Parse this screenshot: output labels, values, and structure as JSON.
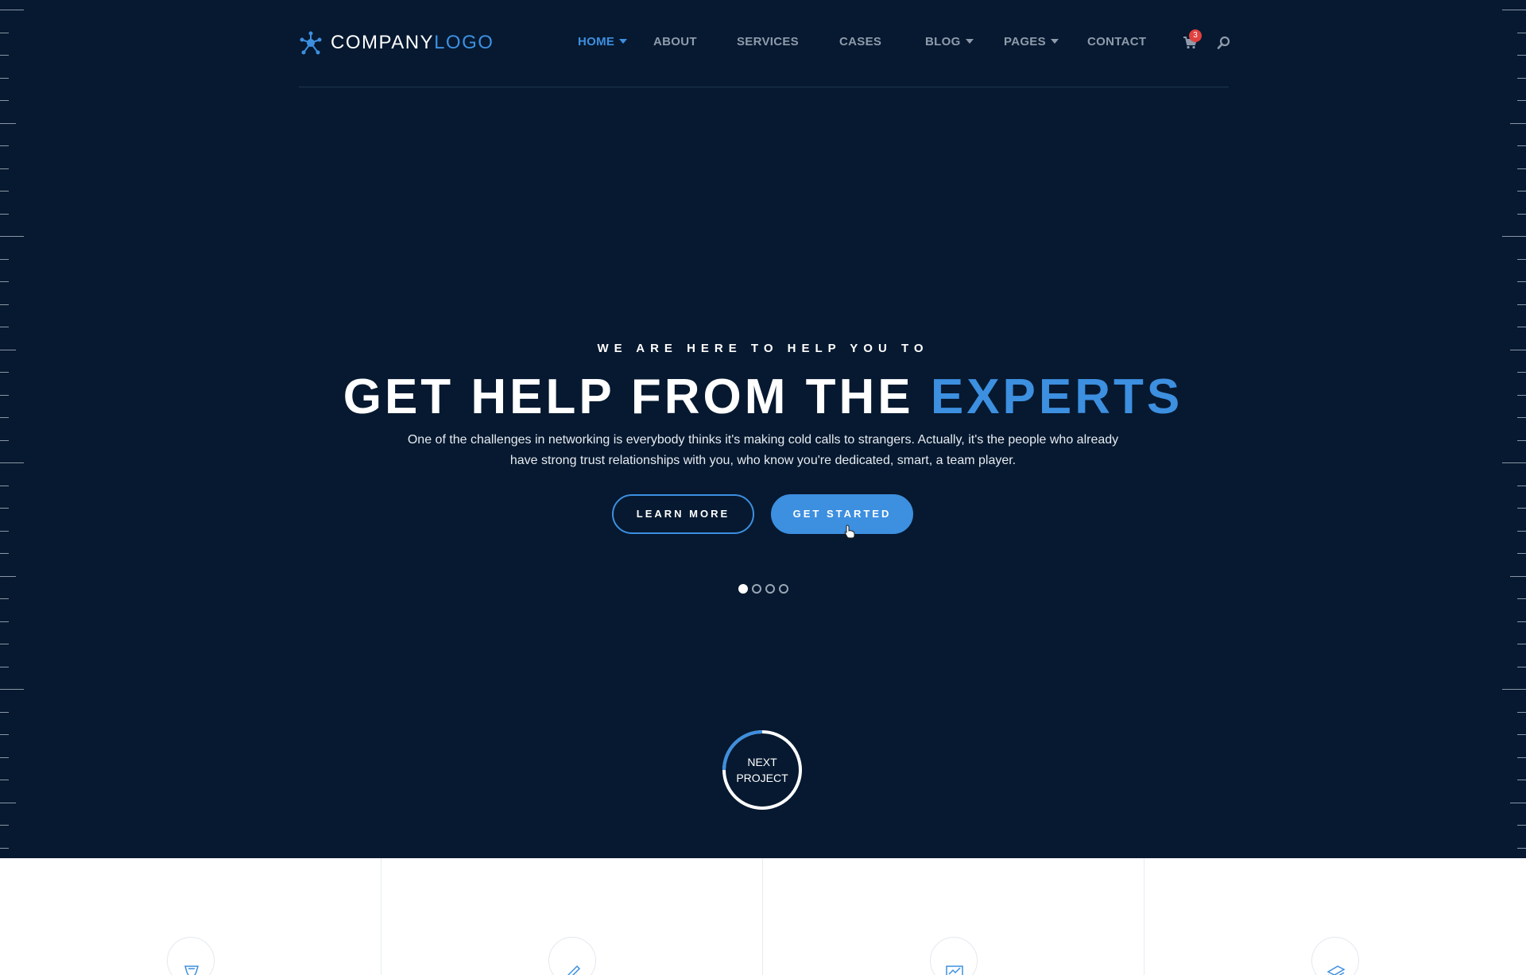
{
  "brand": {
    "logo_primary": "COMPANY",
    "logo_accent": "LOGO",
    "accent_color": "#3d8fe0"
  },
  "nav": {
    "items": [
      {
        "label": "HOME",
        "active": true,
        "dropdown": true
      },
      {
        "label": "ABOUT",
        "active": false,
        "dropdown": false
      },
      {
        "label": "SERVICES",
        "active": false,
        "dropdown": false
      },
      {
        "label": "CASES",
        "active": false,
        "dropdown": false
      },
      {
        "label": "BLOG",
        "active": false,
        "dropdown": true
      },
      {
        "label": "PAGES",
        "active": false,
        "dropdown": true
      },
      {
        "label": "CONTACT",
        "active": false,
        "dropdown": false
      }
    ],
    "cart_count": "3",
    "cart_icon": "cart-icon",
    "search_icon": "search-icon"
  },
  "hero": {
    "eyebrow": "WE ARE HERE TO HELP YOU TO",
    "headline_main": "GET HELP FROM THE",
    "headline_accent": "EXPERTS",
    "lead": "One of the challenges in networking is everybody thinks it's making cold calls to strangers. Actually, it's the people who already have strong trust relationships with you, who know you're dedicated, smart, a team player.",
    "primary_cta": "LEARN MORE",
    "secondary_cta": "GET STARTED",
    "slides_total": 4,
    "slide_active": 1,
    "next_label_line1": "NEXT",
    "next_label_line2": "PROJECT"
  },
  "features": {
    "icons": [
      "shield-icon",
      "pencil-icon",
      "chart-icon",
      "stack-icon"
    ]
  }
}
